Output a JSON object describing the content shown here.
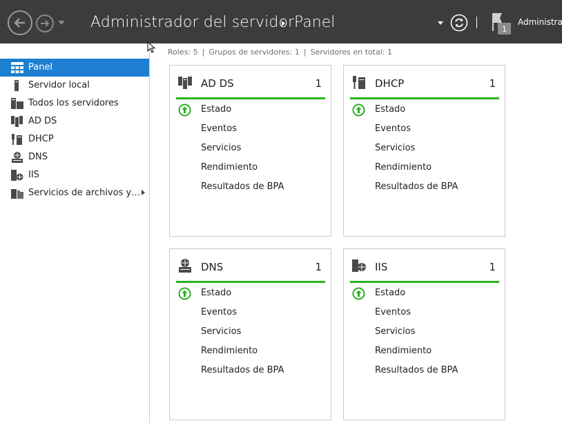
{
  "window": {
    "title": "Administrador del servidor",
    "page": "Panel",
    "account_menu": "Administrar",
    "notification_count": "1"
  },
  "sidebar": {
    "items": [
      {
        "label": "Panel",
        "icon": "dashboard-icon",
        "active": true
      },
      {
        "label": "Servidor local",
        "icon": "server-icon"
      },
      {
        "label": "Todos los servidores",
        "icon": "servers-icon"
      },
      {
        "label": "AD DS",
        "icon": "ad-ds-icon"
      },
      {
        "label": "DHCP",
        "icon": "dhcp-icon"
      },
      {
        "label": "DNS",
        "icon": "dns-icon"
      },
      {
        "label": "IIS",
        "icon": "iis-icon"
      },
      {
        "label": "Servicios de archivos y…",
        "icon": "file-services-icon",
        "expandable": true
      }
    ]
  },
  "summary": {
    "roles": "Roles: 5",
    "groups": "Grupos de servidores: 1",
    "servers": "Servidores en total: 1"
  },
  "tiles": [
    {
      "name": "AD DS",
      "count": "1",
      "icon": "ad-ds-icon",
      "rows": [
        "Estado",
        "Eventos",
        "Servicios",
        "Rendimiento",
        "Resultados de BPA"
      ]
    },
    {
      "name": "DHCP",
      "count": "1",
      "icon": "dhcp-icon",
      "rows": [
        "Estado",
        "Eventos",
        "Servicios",
        "Rendimiento",
        "Resultados de BPA"
      ]
    },
    {
      "name": "DNS",
      "count": "1",
      "icon": "dns-icon",
      "rows": [
        "Estado",
        "Eventos",
        "Servicios",
        "Rendimiento",
        "Resultados de BPA"
      ]
    },
    {
      "name": "IIS",
      "count": "1",
      "icon": "iis-icon",
      "rows": [
        "Estado",
        "Eventos",
        "Servicios",
        "Rendimiento",
        "Resultados de BPA"
      ]
    }
  ],
  "colors": {
    "titlebar": "#3c3c3c",
    "accent": "#1c7fd0",
    "status_ok": "#2bb21e"
  }
}
